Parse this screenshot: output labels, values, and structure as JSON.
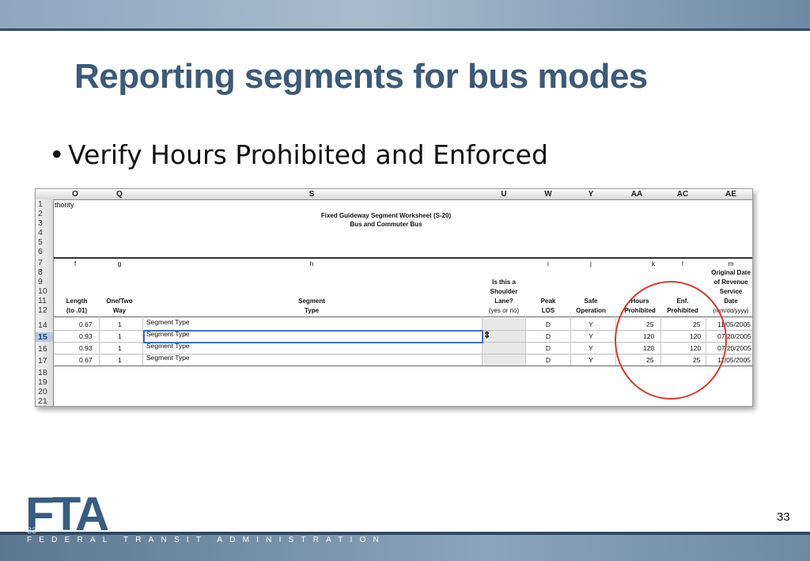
{
  "slide": {
    "title": "Reporting segments for bus modes",
    "bullet": "Verify Hours Prohibited and Enforced",
    "page_number": "33",
    "ghost_page_number": "33",
    "footer_logo": "FTA",
    "footer_text": "FEDERAL TRANSIT ADMINISTRATION"
  },
  "sheet": {
    "columns": [
      "O",
      "Q",
      "S",
      "U",
      "W",
      "Y",
      "AA",
      "AC",
      "AE"
    ],
    "row_numbers": [
      "1",
      "2",
      "3",
      "4",
      "5",
      "6",
      "7",
      "8",
      "9",
      "10",
      "11",
      "12",
      "14",
      "15",
      "16",
      "17",
      "18",
      "19",
      "20",
      "21"
    ],
    "selected_row": "15",
    "authority_fragment": "thority",
    "worksheet_title": "Fixed Guideway Segment Worksheet (S-20)",
    "worksheet_subtitle": "Bus and Commuter Bus",
    "letters": {
      "o": "f",
      "q": "g",
      "s": "h",
      "w": "i",
      "y": "j",
      "aa": "k",
      "ac": "l",
      "ae": "m"
    },
    "headers": {
      "length": [
        "Length",
        "(to .01)"
      ],
      "way": [
        "One/Two",
        "Way"
      ],
      "segment": [
        "Segment",
        "Type"
      ],
      "shoulder": [
        "Is this a",
        "Shoulder",
        "Lane?",
        "(yes or no)"
      ],
      "peak": [
        "Peak",
        "LOS"
      ],
      "safe": [
        "Safe",
        "Operation"
      ],
      "hours": [
        "Hours",
        "Prohibited"
      ],
      "enf": [
        "Enf.",
        "Prohibited"
      ],
      "date": [
        "Original Date",
        "of Revenue",
        "Service",
        "Date",
        "(mm/dd/yyyy)"
      ]
    },
    "rows": [
      {
        "length": "0.67",
        "way": "1",
        "segment": "Segment Type",
        "peak": "D",
        "safe": "Y",
        "hours": "25",
        "enf": "25",
        "date": "11/05/2005"
      },
      {
        "length": "0.93",
        "way": "1",
        "segment": "Segment Type",
        "peak": "D",
        "safe": "Y",
        "hours": "120",
        "enf": "120",
        "date": "07/20/2005"
      },
      {
        "length": "0.93",
        "way": "1",
        "segment": "Segment Type",
        "peak": "D",
        "safe": "Y",
        "hours": "120",
        "enf": "120",
        "date": "07/20/2005"
      },
      {
        "length": "0.67",
        "way": "1",
        "segment": "Segment Type",
        "peak": "D",
        "safe": "Y",
        "hours": "25",
        "enf": "25",
        "date": "11/05/2005"
      }
    ],
    "dropdown_symbol": "⇕"
  },
  "colors": {
    "title": "#3d5a78",
    "highlight_circle": "#d23a30",
    "selection": "#3b6fc0"
  }
}
